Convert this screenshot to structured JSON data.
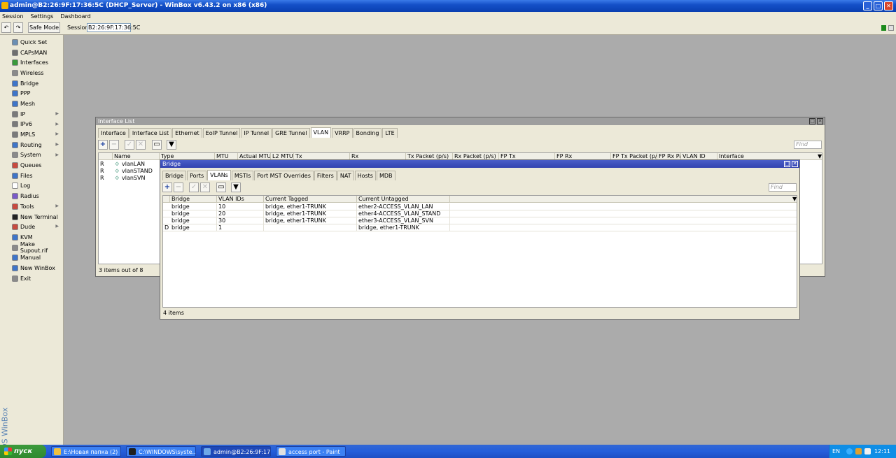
{
  "window": {
    "title": "admin@B2:26:9F:17:36:5C (DHCP_Server) - WinBox v6.43.2 on x86 (x86)",
    "min": "_",
    "max": "□",
    "close": "✕"
  },
  "menubar": [
    "Session",
    "Settings",
    "Dashboard"
  ],
  "toolbar": {
    "undo": "↶",
    "redo": "↷",
    "safe_mode": "Safe Mode",
    "session_label": "Session:",
    "session_value": "B2:26:9F:17:36:5C"
  },
  "sidebar": {
    "brand": "RouterOS WinBox",
    "items": [
      {
        "label": "Quick Set",
        "color": "#6b8fb3"
      },
      {
        "label": "CAPsMAN",
        "color": "#6f6f6f"
      },
      {
        "label": "Interfaces",
        "color": "#3a9a3a"
      },
      {
        "label": "Wireless",
        "color": "#8a8a8a"
      },
      {
        "label": "Bridge",
        "color": "#3f75c8"
      },
      {
        "label": "PPP",
        "color": "#3f75c8"
      },
      {
        "label": "Mesh",
        "color": "#3f75c8"
      },
      {
        "label": "IP",
        "color": "#7a7a7a"
      },
      {
        "label": "IPv6",
        "color": "#7a7a7a"
      },
      {
        "label": "MPLS",
        "color": "#7a7a7a"
      },
      {
        "label": "Routing",
        "color": "#3f75c8"
      },
      {
        "label": "System",
        "color": "#8a8a8a"
      },
      {
        "label": "Queues",
        "color": "#c84a3f"
      },
      {
        "label": "Files",
        "color": "#3f75c8"
      },
      {
        "label": "Log",
        "color": "#ffffff"
      },
      {
        "label": "Radius",
        "color": "#7a5ac8"
      },
      {
        "label": "Tools",
        "color": "#c84a3f"
      },
      {
        "label": "New Terminal",
        "color": "#222222"
      },
      {
        "label": "Dude",
        "color": "#c84a3f"
      },
      {
        "label": "KVM",
        "color": "#3f75c8"
      },
      {
        "label": "Make Supout.rif",
        "color": "#8a8a8a"
      },
      {
        "label": "Manual",
        "color": "#3f75c8"
      },
      {
        "label": "New WinBox",
        "color": "#3f75c8"
      },
      {
        "label": "Exit",
        "color": "#8a8a8a"
      }
    ]
  },
  "interface_list": {
    "title": "Interface List",
    "tabs": [
      "Interface",
      "Interface List",
      "Ethernet",
      "EoIP Tunnel",
      "IP Tunnel",
      "GRE Tunnel",
      "VLAN",
      "VRRP",
      "Bonding",
      "LTE"
    ],
    "active_tab": "VLAN",
    "find_placeholder": "Find",
    "columns": [
      "Name",
      "Type",
      "MTU",
      "Actual MTU",
      "L2 MTU",
      "Tx",
      "Rx",
      "Tx Packet (p/s)",
      "Rx Packet (p/s)",
      "FP Tx",
      "FP Rx",
      "FP Tx Packet (p/s)",
      "FP Rx Packet (p/s)",
      "VLAN ID",
      "Interface"
    ],
    "rows": [
      {
        "flag": "R",
        "name": "vlanLAN"
      },
      {
        "flag": "R",
        "name": "vlanSTAND"
      },
      {
        "flag": "R",
        "name": "vlanSVN"
      }
    ],
    "status": "3 items out of 8"
  },
  "bridge": {
    "title": "Bridge",
    "tabs": [
      "Bridge",
      "Ports",
      "VLANs",
      "MSTIs",
      "Port MST Overrides",
      "Filters",
      "NAT",
      "Hosts",
      "MDB"
    ],
    "active_tab": "VLANs",
    "find_placeholder": "Find",
    "columns": [
      "Bridge",
      "VLAN IDs",
      "Current Tagged",
      "Current Untagged"
    ],
    "rows": [
      {
        "flag": "",
        "bridge": "bridge",
        "vlan_ids": "10",
        "tagged": "bridge, ether1-TRUNK",
        "untagged": "ether2-ACCESS_VLAN_LAN"
      },
      {
        "flag": "",
        "bridge": "bridge",
        "vlan_ids": "20",
        "tagged": "bridge, ether1-TRUNK",
        "untagged": "ether4-ACCESS_VLAN_STAND"
      },
      {
        "flag": "",
        "bridge": "bridge",
        "vlan_ids": "30",
        "tagged": "bridge, ether1-TRUNK",
        "untagged": "ether3-ACCESS_VLAN_SVN"
      },
      {
        "flag": "D",
        "bridge": "bridge",
        "vlan_ids": "1",
        "tagged": "",
        "untagged": "bridge, ether1-TRUNK"
      }
    ],
    "status": "4 items"
  },
  "taskbar": {
    "start": "пуск",
    "tasks": [
      {
        "label": "E:\\Новая папка (2)",
        "color": "#f0c040",
        "active": false
      },
      {
        "label": "C:\\WINDOWS\\syste...",
        "color": "#202020",
        "active": false
      },
      {
        "label": "admin@B2:26:9F:17:...",
        "color": "#6fa8e8",
        "active": true
      },
      {
        "label": "access port - Paint",
        "color": "#e0e0e0",
        "active": false
      }
    ],
    "lang": "EN",
    "clock": "12:11"
  }
}
